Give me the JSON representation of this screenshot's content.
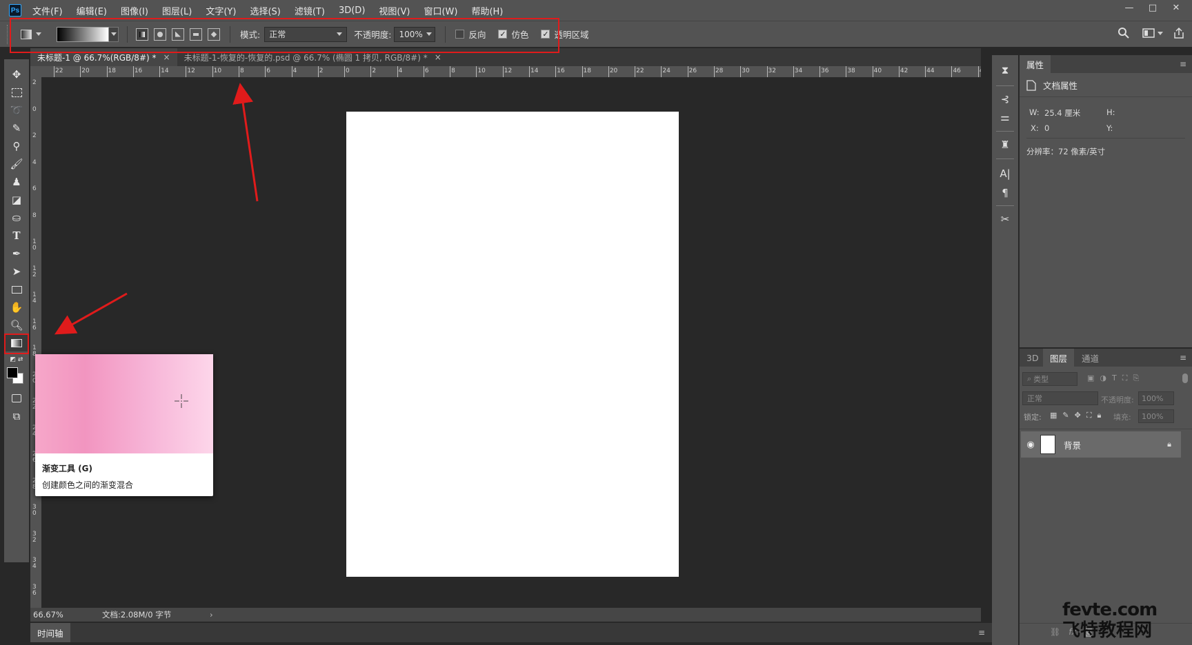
{
  "app": {
    "logo": "Ps",
    "window_controls": [
      "—",
      "□",
      "✕"
    ]
  },
  "menu": [
    "文件(F)",
    "编辑(E)",
    "图像(I)",
    "图层(L)",
    "文字(Y)",
    "选择(S)",
    "滤镜(T)",
    "3D(D)",
    "视图(V)",
    "窗口(W)",
    "帮助(H)"
  ],
  "options": {
    "mode_label": "模式:",
    "mode_value": "正常",
    "opacity_label": "不透明度:",
    "opacity_value": "100%",
    "reverse_label": "反向",
    "reverse_checked": false,
    "dither_label": "仿色",
    "dither_checked": true,
    "transparency_label": "透明区域",
    "transparency_checked": true,
    "gradient_types": [
      "linear-gradient-icon",
      "radial-gradient-icon",
      "angle-gradient-icon",
      "reflected-gradient-icon",
      "diamond-gradient-icon"
    ]
  },
  "tabs": [
    {
      "label": "未标题-1 @ 66.7%(RGB/8#) *",
      "active": true
    },
    {
      "label": "未标题-1-恢复的-恢复的.psd @ 66.7% (椭圆 1 拷贝, RGB/8#) *",
      "active": false
    }
  ],
  "ruler": {
    "h_ticks": [
      "22",
      "20",
      "18",
      "16",
      "14",
      "12",
      "10",
      "8",
      "6",
      "4",
      "2",
      "0",
      "2",
      "4",
      "6",
      "8",
      "10",
      "12",
      "14",
      "16",
      "18",
      "20",
      "22",
      "24",
      "26",
      "28",
      "30",
      "32",
      "34",
      "36",
      "38",
      "40",
      "42",
      "44",
      "46",
      "4"
    ],
    "v_ticks": [
      "2",
      "0",
      "2",
      "4",
      "6",
      "8",
      "1 0",
      "1 2",
      "1 4",
      "1 6",
      "1 8",
      "2 0",
      "2 2",
      "2 4",
      "2 6",
      "2 8",
      "3 0",
      "3 2",
      "3 4",
      "3 6"
    ]
  },
  "tooltip": {
    "title": "渐变工具 (G)",
    "description": "创建颜色之间的渐变混合"
  },
  "status": {
    "zoom": "66.67%",
    "doc_info": "文档:2.08M/0 字节"
  },
  "timeline": {
    "label": "时间轴"
  },
  "properties": {
    "tab": "属性",
    "section": "文档属性",
    "w_label": "W:",
    "w_value": "25.4 厘米",
    "h_label": "H:",
    "x_label": "X:",
    "x_value": "0",
    "y_label": "Y:",
    "resolution": "分辨率：72 像素/英寸"
  },
  "layers_panel": {
    "tabs": [
      "3D",
      "图层",
      "通道"
    ],
    "active_tab": "图层",
    "filter_placeholder": "类型",
    "blend_mode": "正常",
    "opacity_label": "不透明度:",
    "opacity_value": "100%",
    "lock_label": "锁定:",
    "fill_label": "填充:",
    "fill_value": "100%",
    "layers": [
      {
        "name": "背景",
        "visible": true,
        "locked": true
      }
    ]
  },
  "watermark": {
    "line1": "fevte.com",
    "line2": "飞特教程网"
  },
  "colors": {
    "highlight_red": "#e01b1b",
    "panel": "#535353",
    "canvas_bg": "#282828",
    "gradient_pink": "#f295c0"
  }
}
